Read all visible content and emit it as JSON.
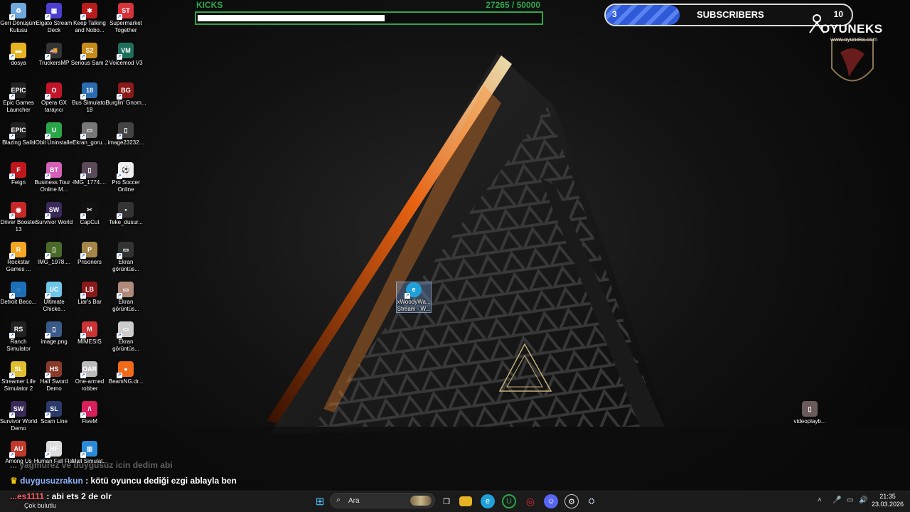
{
  "desktop_icons": [
    {
      "label": "Geri Dönüşüm Kutusu",
      "icon": "recycle-bin-icon",
      "color": "#6fa8dc",
      "glyph": "♻"
    },
    {
      "label": "Elgato Stream Deck",
      "icon": "stream-deck-icon",
      "color": "#4b3fd1",
      "glyph": "▦"
    },
    {
      "label": "Keep Talking and Nobo...",
      "icon": "keep-talking-icon",
      "color": "#b81c1c",
      "glyph": "✱"
    },
    {
      "label": "Supermarket Together",
      "icon": "supermarket-together-icon",
      "color": "#d8323a",
      "glyph": "ST"
    },
    {
      "label": "dosya",
      "icon": "folder-icon",
      "color": "#e6b422",
      "glyph": "▬"
    },
    {
      "label": "TruckersMP",
      "icon": "truckersmp-icon",
      "color": "#333333",
      "glyph": "🚚"
    },
    {
      "label": "Serious Sam 2",
      "icon": "serious-sam-icon",
      "color": "#c78a1b",
      "glyph": "S2"
    },
    {
      "label": "Voicemod V3",
      "icon": "voicemod-icon",
      "color": "#1e6e5a",
      "glyph": "VM"
    },
    {
      "label": "Epic Games Launcher",
      "icon": "epic-games-icon",
      "color": "#222222",
      "glyph": "EPIC"
    },
    {
      "label": "Opera GX tarayıcı",
      "icon": "opera-gx-icon",
      "color": "#c2152a",
      "glyph": "O"
    },
    {
      "label": "Bus Simulator 18",
      "icon": "bus-simulator-icon",
      "color": "#2b6cb0",
      "glyph": "18"
    },
    {
      "label": "Burglin' Gnom...",
      "icon": "burglin-gnomes-icon",
      "color": "#8b1a1a",
      "glyph": "BG"
    },
    {
      "label": "Blazing Sails",
      "icon": "epic-games-icon",
      "color": "#222222",
      "glyph": "EPIC"
    },
    {
      "label": "IObit Uninstaller",
      "icon": "iobit-uninstaller-icon",
      "color": "#2aa64a",
      "glyph": "U"
    },
    {
      "label": "Ekran_goru...",
      "icon": "screenshot-file-icon",
      "color": "#777777",
      "glyph": "▭"
    },
    {
      "label": "image23232...",
      "icon": "image-file-icon",
      "color": "#444444",
      "glyph": "▯"
    },
    {
      "label": "Feign",
      "icon": "feign-icon",
      "color": "#c0161d",
      "glyph": "F"
    },
    {
      "label": "Business Tour - Online M...",
      "icon": "business-tour-icon",
      "color": "#d65fb7",
      "glyph": "BT"
    },
    {
      "label": "IMG_1774....",
      "icon": "image-file-icon",
      "color": "#5a4a5a",
      "glyph": "▯"
    },
    {
      "label": "Pro Soccer Online",
      "icon": "pro-soccer-icon",
      "color": "#eeeeee",
      "glyph": "⚽"
    },
    {
      "label": "Driver Booster 13",
      "icon": "driver-booster-icon",
      "color": "#c62828",
      "glyph": "◉"
    },
    {
      "label": "Survivor World",
      "icon": "survivor-world-icon",
      "color": "#3a2a5a",
      "glyph": "SW"
    },
    {
      "label": "CapCut",
      "icon": "capcut-icon",
      "color": "#111111",
      "glyph": "✂"
    },
    {
      "label": "Teke_dusur...",
      "icon": "video-file-icon",
      "color": "#333333",
      "glyph": "▪"
    },
    {
      "label": "Rockstar Games ...",
      "icon": "rockstar-icon",
      "color": "#f5a623",
      "glyph": "R"
    },
    {
      "label": "IMG_1978....",
      "icon": "image-file-icon",
      "color": "#4a6a2a",
      "glyph": "▯"
    },
    {
      "label": "Prisoners",
      "icon": "prisoners-icon",
      "color": "#a5864a",
      "glyph": "P"
    },
    {
      "label": "Ekran görüntüs...",
      "icon": "screenshot-file-icon",
      "color": "#333333",
      "glyph": "▭"
    },
    {
      "label": "Detroit Beco...",
      "icon": "detroit-icon",
      "color": "#1d6fb8",
      "glyph": "◌"
    },
    {
      "label": "Ultimate Chicke...",
      "icon": "ultimate-chicken-horse-icon",
      "color": "#6fc6e8",
      "glyph": "UC"
    },
    {
      "label": "Liar's Bar",
      "icon": "liars-bar-icon",
      "color": "#8a1a1a",
      "glyph": "LB"
    },
    {
      "label": "Ekran görüntüs...",
      "icon": "screenshot-file-icon",
      "color": "#b08a7a",
      "glyph": "▭"
    },
    {
      "label": "Ranch Simulator",
      "icon": "ranch-simulator-icon",
      "color": "#222222",
      "glyph": "RS"
    },
    {
      "label": "image.png",
      "icon": "image-file-icon",
      "color": "#3a5a8a",
      "glyph": "▯"
    },
    {
      "label": "MIMESIS",
      "icon": "mimesis-icon",
      "color": "#cc3333",
      "glyph": "M"
    },
    {
      "label": "Ekran görüntüs...",
      "icon": "screenshot-file-icon",
      "color": "#cccccc",
      "glyph": "▭"
    },
    {
      "label": "Streamer Life Simulator 2",
      "icon": "streamer-life-icon",
      "color": "#e0c030",
      "glyph": "SL"
    },
    {
      "label": "Half Sword Demo",
      "icon": "half-sword-icon",
      "color": "#8a3a2a",
      "glyph": "HS"
    },
    {
      "label": "One-armed robber",
      "icon": "one-armed-robber-icon",
      "color": "#bbbbbb",
      "glyph": "OAR"
    },
    {
      "label": "BeamNG.dr...",
      "icon": "beamng-icon",
      "color": "#f06a1a",
      "glyph": "●"
    },
    {
      "label": "Survivor World Demo",
      "icon": "survivor-world-icon",
      "color": "#3a2a5a",
      "glyph": "SW"
    },
    {
      "label": "Scam Line",
      "icon": "scam-line-icon",
      "color": "#2a3a6a",
      "glyph": "SL"
    },
    {
      "label": "FiveM",
      "icon": "fivem-icon",
      "color": "#d81e5b",
      "glyph": "/\\"
    },
    {
      "label": "",
      "icon": "blank-slot-icon",
      "color": "#000000",
      "glyph": ""
    },
    {
      "label": "Among Us",
      "icon": "among-us-icon",
      "color": "#c0392b",
      "glyph": "AU"
    },
    {
      "label": "Human Fall Flat",
      "icon": "human-fall-flat-icon",
      "color": "#dddddd",
      "glyph": "HF"
    },
    {
      "label": "Mall Simulat...",
      "icon": "mall-simulator-icon",
      "color": "#2a8ad8",
      "glyph": "▥"
    },
    {
      "label": "",
      "icon": "blank-slot-icon",
      "color": "#000000",
      "glyph": ""
    }
  ],
  "extra_icons": {
    "center": {
      "label": "xWoodyWa... Stream - W...",
      "icon": "edge-shortcut-icon"
    },
    "right": {
      "label": "videoplayb...",
      "icon": "video-file-icon"
    }
  },
  "kicks": {
    "title": "KICKS",
    "current": "27265",
    "goal": " / 50000",
    "fraction": 0.545
  },
  "subscribers": {
    "current": "3",
    "label": "SUBSCRIBERS",
    "goal": "10",
    "fraction": 0.3
  },
  "brand": {
    "name": "OYUNEKS",
    "url": "www.oyuneks.com"
  },
  "chat": [
    {
      "user": "",
      "message": "... yagmurez ve duygusuz icin dedim abi",
      "faded": true
    },
    {
      "user": "duygusuzrakun",
      "message": " : kötü oyuncu dediği ezgi ablayla ben",
      "faded": false
    },
    {
      "user": "...es1111",
      "message": " : abi ets 2 de olr",
      "faded": false
    }
  ],
  "taskbar": {
    "weather": "Çok bulutlu",
    "search_placeholder": "Ara",
    "time": "21:35",
    "date": "23.03.2026",
    "apps": [
      "windows-start-icon",
      "task-view-icon",
      "file-explorer-icon",
      "edge-icon",
      "iobit-icon",
      "opera-gx-icon",
      "discord-icon",
      "steam-client-icon",
      "steam-icon"
    ]
  },
  "colors": {
    "kicks_green": "#2fa64b",
    "subs_blue": "#2e59d9",
    "accent_orange": "#ff7a1a"
  }
}
